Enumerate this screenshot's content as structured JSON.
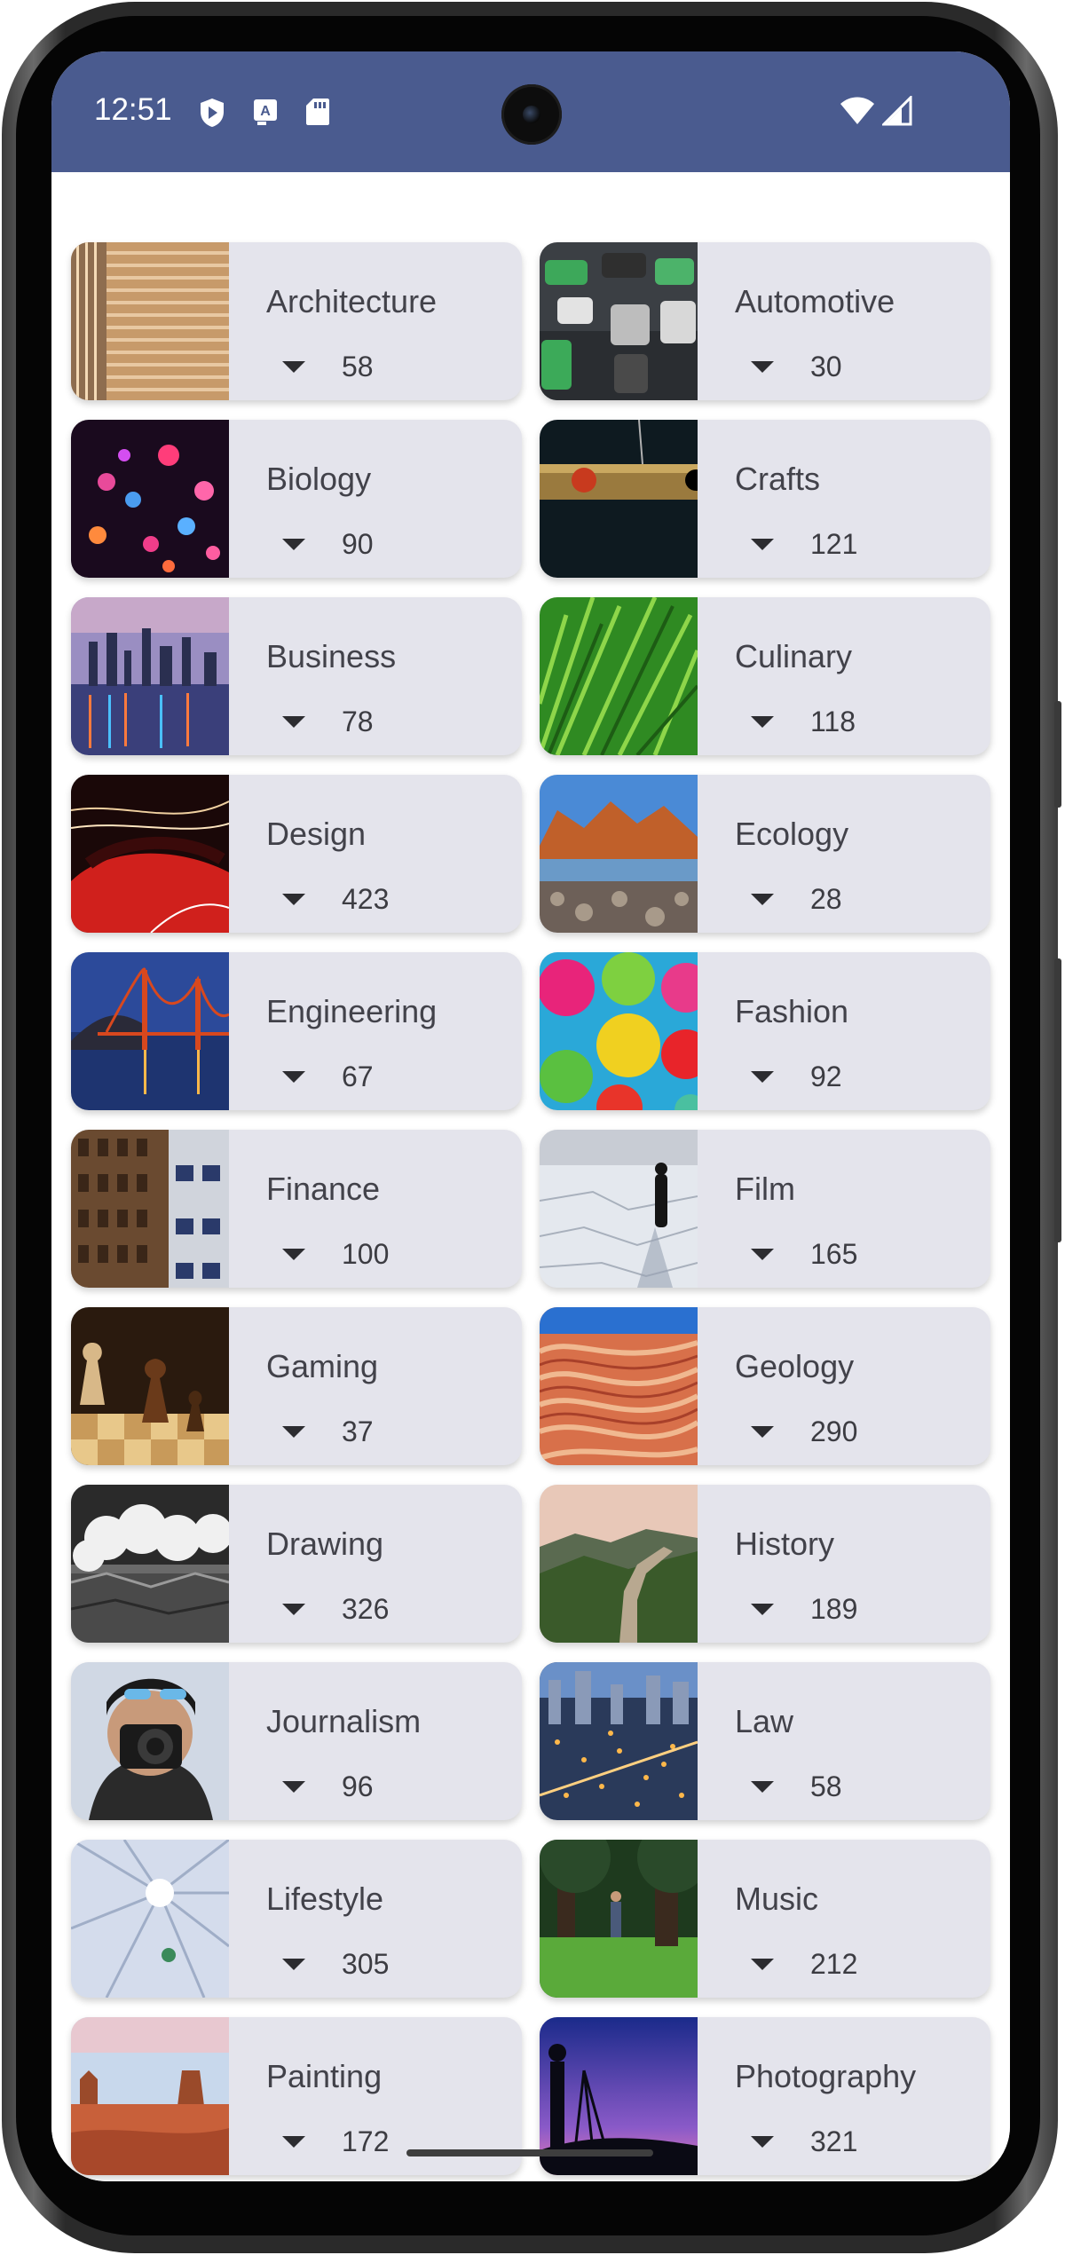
{
  "status_bar": {
    "time": "12:51",
    "left_icons": [
      "play-protect-icon",
      "translate-icon",
      "sd-card-icon"
    ],
    "right_icons": [
      "wifi-icon",
      "cellular-signal-icon"
    ],
    "background": "#4a5b8f"
  },
  "cards": [
    {
      "title": "Architecture",
      "count": "58"
    },
    {
      "title": "Automotive",
      "count": "30"
    },
    {
      "title": "Biology",
      "count": "90"
    },
    {
      "title": "Crafts",
      "count": "121"
    },
    {
      "title": "Business",
      "count": "78"
    },
    {
      "title": "Culinary",
      "count": "118"
    },
    {
      "title": "Design",
      "count": "423"
    },
    {
      "title": "Ecology",
      "count": "28"
    },
    {
      "title": "Engineering",
      "count": "67"
    },
    {
      "title": "Fashion",
      "count": "92"
    },
    {
      "title": "Finance",
      "count": "100"
    },
    {
      "title": "Film",
      "count": "165"
    },
    {
      "title": "Gaming",
      "count": "37"
    },
    {
      "title": "Geology",
      "count": "290"
    },
    {
      "title": "Drawing",
      "count": "326"
    },
    {
      "title": "History",
      "count": "189"
    },
    {
      "title": "Journalism",
      "count": "96"
    },
    {
      "title": "Law",
      "count": "58"
    },
    {
      "title": "Lifestyle",
      "count": "305"
    },
    {
      "title": "Music",
      "count": "212"
    },
    {
      "title": "Painting",
      "count": "172"
    },
    {
      "title": "Photography",
      "count": "321"
    }
  ],
  "card_background": "#e4e4ec"
}
